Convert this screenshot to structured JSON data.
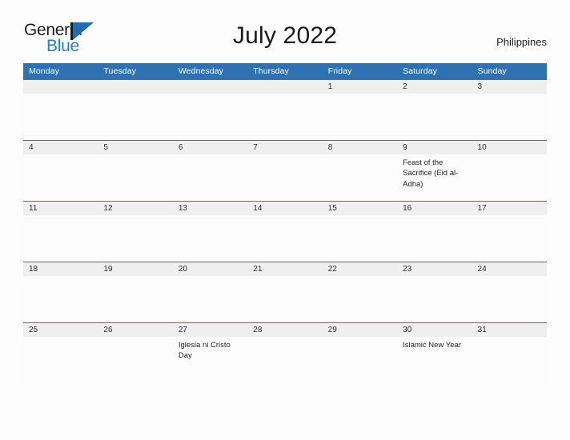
{
  "brand": {
    "name_line1": "General",
    "name_line2": "Blue",
    "mark_icon": "flag-triangle-icon",
    "accent_color": "#1f6cb4",
    "accent_light_color": "#1f7fd4"
  },
  "header": {
    "title": "July 2022",
    "country": "Philippines",
    "header_bg_color": "#2f72b3",
    "datestrip_bg_color": "#efefef"
  },
  "calendar": {
    "weekdays": [
      "Monday",
      "Tuesday",
      "Wednesday",
      "Thursday",
      "Friday",
      "Saturday",
      "Sunday"
    ],
    "weeks": [
      {
        "days": [
          {
            "date": "",
            "events": []
          },
          {
            "date": "",
            "events": []
          },
          {
            "date": "",
            "events": []
          },
          {
            "date": "",
            "events": []
          },
          {
            "date": "1",
            "events": []
          },
          {
            "date": "2",
            "events": []
          },
          {
            "date": "3",
            "events": []
          }
        ]
      },
      {
        "days": [
          {
            "date": "4",
            "events": []
          },
          {
            "date": "5",
            "events": []
          },
          {
            "date": "6",
            "events": []
          },
          {
            "date": "7",
            "events": []
          },
          {
            "date": "8",
            "events": []
          },
          {
            "date": "9",
            "events": [
              "Feast of the Sacrifice (Eid al-Adha)"
            ]
          },
          {
            "date": "10",
            "events": []
          }
        ]
      },
      {
        "days": [
          {
            "date": "11",
            "events": []
          },
          {
            "date": "12",
            "events": []
          },
          {
            "date": "13",
            "events": []
          },
          {
            "date": "14",
            "events": []
          },
          {
            "date": "15",
            "events": []
          },
          {
            "date": "16",
            "events": []
          },
          {
            "date": "17",
            "events": []
          }
        ]
      },
      {
        "days": [
          {
            "date": "18",
            "events": []
          },
          {
            "date": "19",
            "events": []
          },
          {
            "date": "20",
            "events": []
          },
          {
            "date": "21",
            "events": []
          },
          {
            "date": "22",
            "events": []
          },
          {
            "date": "23",
            "events": []
          },
          {
            "date": "24",
            "events": []
          }
        ]
      },
      {
        "days": [
          {
            "date": "25",
            "events": []
          },
          {
            "date": "26",
            "events": []
          },
          {
            "date": "27",
            "events": [
              "Iglesia ni Cristo Day"
            ]
          },
          {
            "date": "28",
            "events": []
          },
          {
            "date": "29",
            "events": []
          },
          {
            "date": "30",
            "events": [
              "Islamic New Year"
            ]
          },
          {
            "date": "31",
            "events": []
          }
        ]
      }
    ]
  }
}
